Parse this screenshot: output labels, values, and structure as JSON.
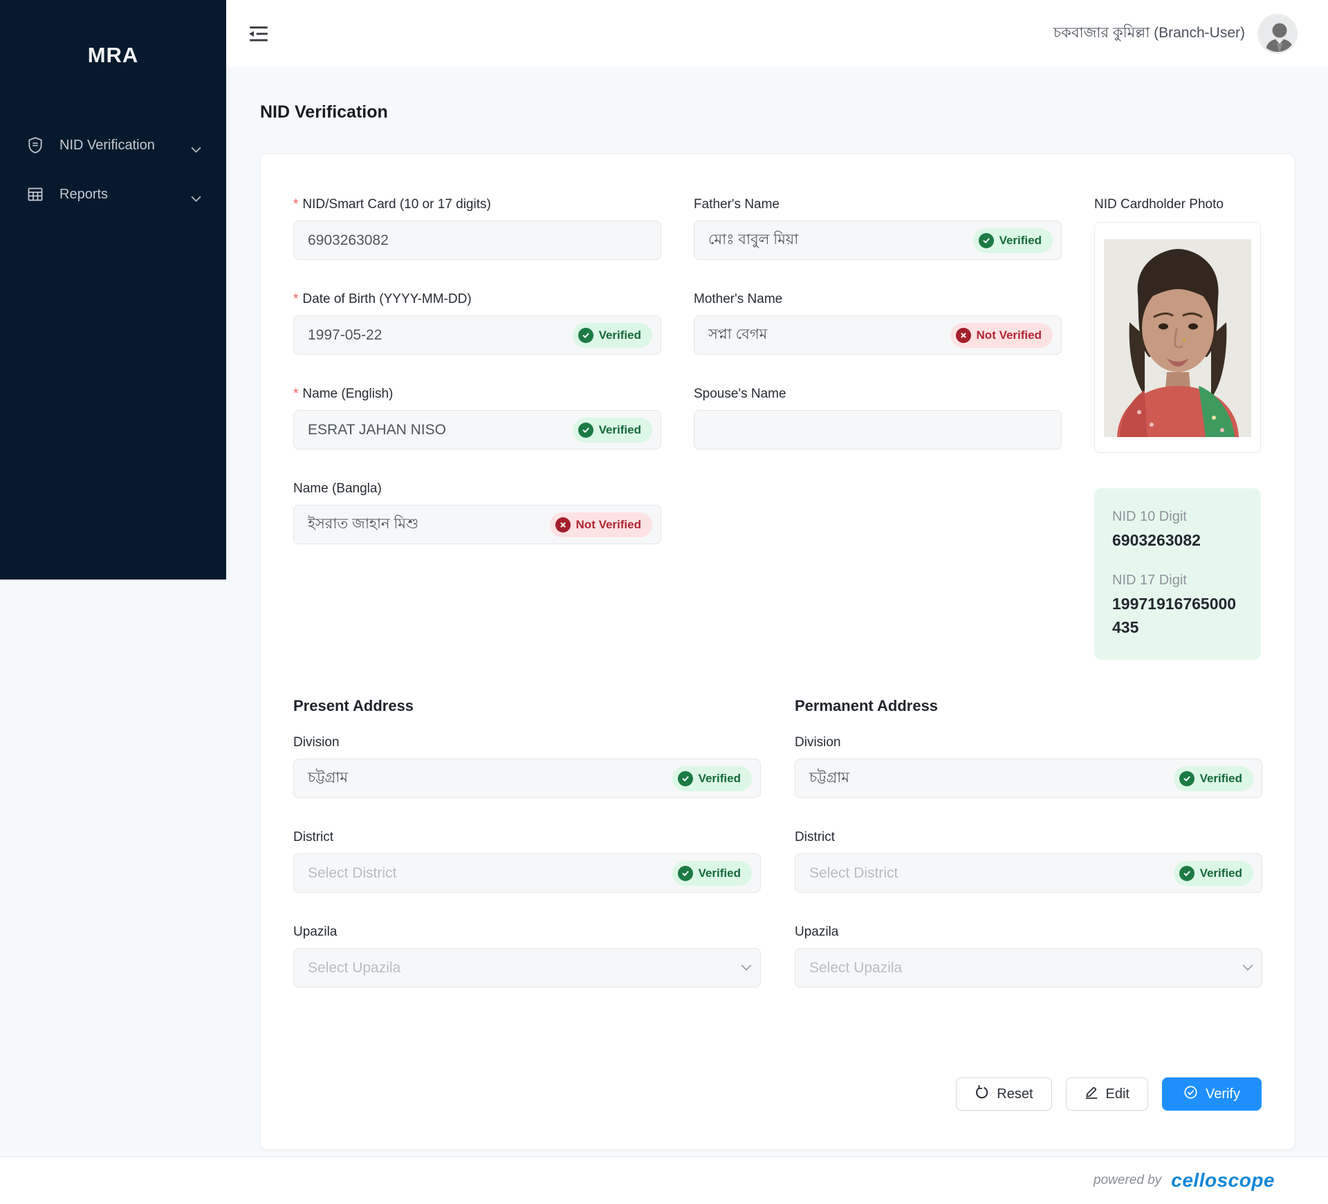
{
  "icons": {
    "sidebar_nid": "id-shield-icon",
    "sidebar_reports": "table-icon",
    "menu_expand": "chevron-down-icon",
    "topbar": "menu-fold-icon",
    "user": "avatar-silhouette",
    "verified": "check-circle-icon",
    "not_verified": "x-circle-icon",
    "reset": "reload-icon",
    "edit": "pencil-icon",
    "verify": "check-circle-icon",
    "select": "chevron-down-icon"
  },
  "colors": {
    "sidebar_bg": "#071a2d",
    "page_bg": "#f5f9fc",
    "primary_blue": "#1f90fb",
    "verified_text": "#15693a",
    "verified_bg": "#dcf7e6",
    "not_verified_text": "#b02633",
    "not_verified_bg": "#fde2e4",
    "nid_box_bg": "#e6f8ee",
    "celloscope_blue": "#1486d8"
  },
  "sidebar": {
    "brand": "MRA",
    "items": [
      {
        "label": "NID Verification"
      },
      {
        "label": "Reports"
      }
    ]
  },
  "header": {
    "user_name": "চকবাজার কুমিল্লা (Branch-User)"
  },
  "page": {
    "title": "NID Verification"
  },
  "form": {
    "required_marker": "*",
    "badges": {
      "verified": "Verified",
      "not_verified": "Not Verified"
    },
    "fields": {
      "nid": {
        "label": "NID/Smart Card (10 or 17 digits)",
        "value": "6903263082"
      },
      "dob": {
        "label": "Date of Birth (YYYY-MM-DD)",
        "value": "1997-05-22"
      },
      "name_en": {
        "label": "Name (English)",
        "value": "ESRAT JAHAN NISO"
      },
      "name_bn": {
        "label": "Name (Bangla)",
        "value": "ইসরাত জাহান মিশু"
      },
      "father": {
        "label": "Father's Name",
        "value": "মোঃ বাবুল মিয়া"
      },
      "mother": {
        "label": "Mother's Name",
        "value": "সপ্না বেগম"
      },
      "spouse": {
        "label": "Spouse's Name",
        "value": ""
      }
    },
    "photo": {
      "label": "NID Cardholder Photo"
    },
    "nid_summary": {
      "nid10_label": "NID 10 Digit",
      "nid10_value": "6903263082",
      "nid17_label": "NID 17 Digit",
      "nid17_value": "19971916765000435"
    },
    "present_address": {
      "title": "Present Address",
      "division_label": "Division",
      "division_value": "চট্টগ্রাম",
      "district_label": "District",
      "district_placeholder": "Select District",
      "upazila_label": "Upazila",
      "upazila_placeholder": "Select Upazila"
    },
    "permanent_address": {
      "title": "Permanent Address",
      "division_label": "Division",
      "division_value": "চট্টগ্রাম",
      "district_label": "District",
      "district_placeholder": "Select District",
      "upazila_label": "Upazila",
      "upazila_placeholder": "Select Upazila"
    },
    "actions": {
      "reset": "Reset",
      "edit": "Edit",
      "verify": "Verify"
    }
  },
  "footer": {
    "powered_by": "powered by",
    "brand": "celloscope"
  }
}
